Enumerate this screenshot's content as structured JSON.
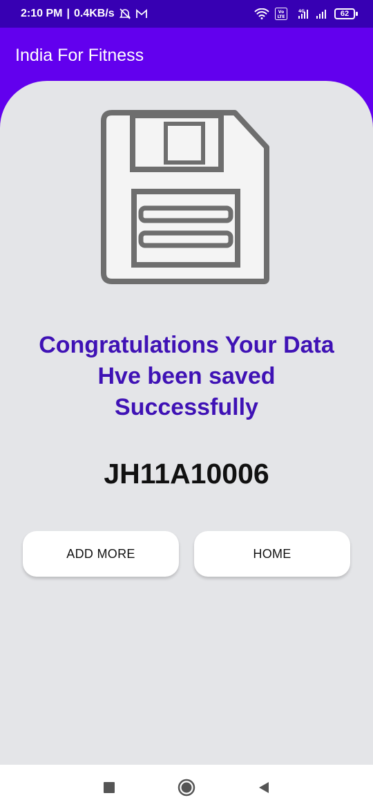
{
  "status_bar": {
    "time": "2:10 PM",
    "net_speed": "0.4KB/s",
    "battery": "62",
    "network_type": "4G",
    "volte": "Vo LTE",
    "icons": [
      "alarm-off-icon",
      "gmail-icon",
      "wifi-icon",
      "signal-icon",
      "battery-icon"
    ]
  },
  "app_bar": {
    "title": "India For Fitness"
  },
  "main": {
    "illustration": "save-icon",
    "message": "Congratulations Your Data Hve been saved Successfully",
    "record_id": "JH11A10006",
    "buttons": {
      "add_more": "ADD MORE",
      "home": "HOME"
    }
  },
  "nav_bar": {
    "icons": [
      "recent-apps-icon",
      "home-icon",
      "back-icon"
    ]
  },
  "colors": {
    "status_bar": "#3700B3",
    "app_bar": "#6200EE",
    "content_bg": "#E4E5E8",
    "message": "#3F12B5"
  }
}
